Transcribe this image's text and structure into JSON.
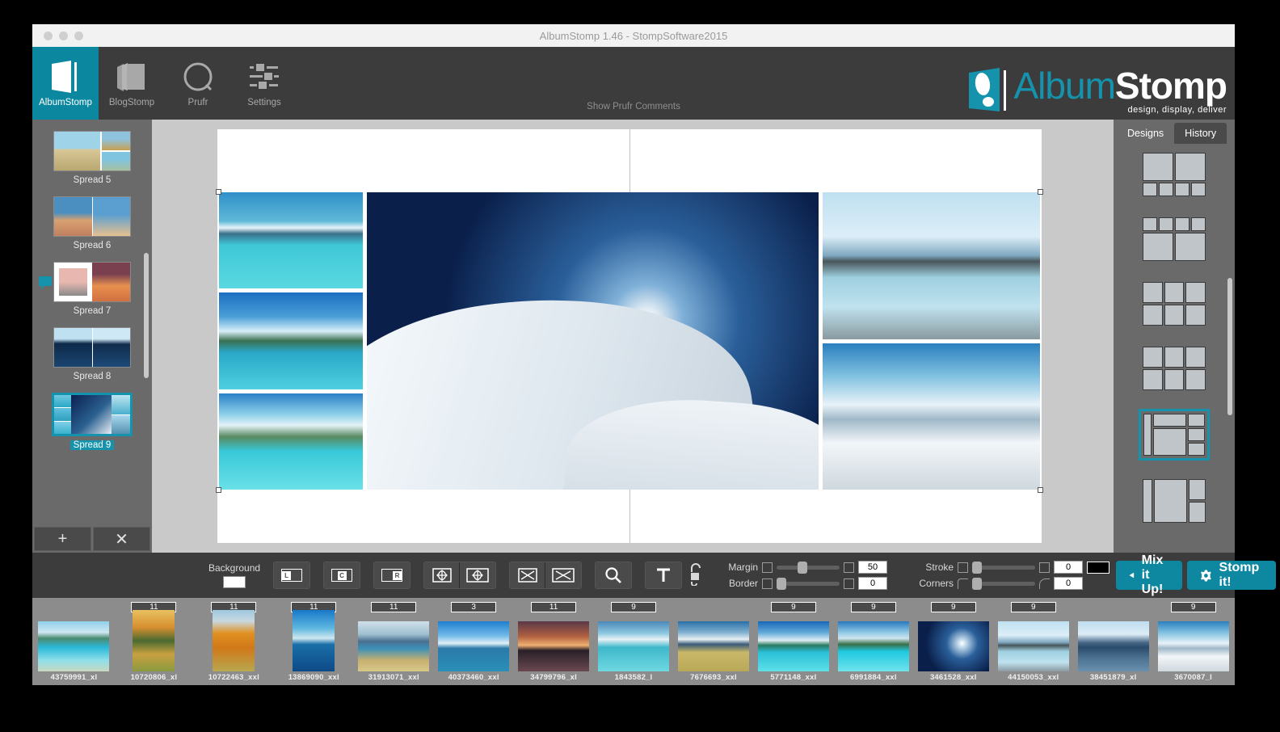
{
  "window": {
    "title": "AlbumStomp 1.46 - StompSoftware2015"
  },
  "topnav": {
    "items": [
      {
        "label": "AlbumStomp",
        "icon": "album-icon",
        "active": true
      },
      {
        "label": "BlogStomp",
        "icon": "blog-icon",
        "active": false
      },
      {
        "label": "Prufr",
        "icon": "circle-icon",
        "active": false
      },
      {
        "label": "Settings",
        "icon": "sliders-icon",
        "active": false
      }
    ],
    "prufr_link": "Show Prufr Comments",
    "logo": {
      "left": "Album",
      "right": "Stomp",
      "tagline": "design, display, deliver"
    }
  },
  "sidebar": {
    "spreads": [
      {
        "label": "Spread 5",
        "selected": false,
        "comment": false
      },
      {
        "label": "Spread 6",
        "selected": false,
        "comment": false
      },
      {
        "label": "Spread 7",
        "selected": false,
        "comment": true
      },
      {
        "label": "Spread 8",
        "selected": false,
        "comment": false
      },
      {
        "label": "Spread 9",
        "selected": true,
        "comment": false
      }
    ],
    "add_label": "+",
    "remove_label": "✕"
  },
  "rightpanel": {
    "tabs": [
      {
        "label": "Designs",
        "active": true
      },
      {
        "label": "History",
        "active": false
      }
    ],
    "selected_design_index": 4
  },
  "toolbar": {
    "menu_icon": "hamburger-icon",
    "background_label": "Background",
    "background_color": "#ffffff",
    "align_left": "L",
    "align_center": "C",
    "align_right": "R",
    "zoom_icon": "search-icon",
    "text_icon": "text-icon",
    "lock_icon": "unlock-icon",
    "margin_label": "Margin",
    "margin_value": "50",
    "border_label": "Border",
    "border_value": "0",
    "stroke_label": "Stroke",
    "stroke_value": "0",
    "stroke_color": "#000000",
    "corners_label": "Corners",
    "corners_value": "0",
    "mix_label": "Mix it Up!",
    "stomp_label": "Stomp it!",
    "accent_color": "#0e87a1"
  },
  "filmstrip": [
    {
      "name": "43759991_xl",
      "badge": "",
      "orientation": "landscape"
    },
    {
      "name": "10720806_xl",
      "badge": "11",
      "orientation": "portrait"
    },
    {
      "name": "10722463_xxl",
      "badge": "11",
      "orientation": "portrait"
    },
    {
      "name": "13869090_xxl",
      "badge": "11",
      "orientation": "portrait"
    },
    {
      "name": "31913071_xxl",
      "badge": "11",
      "orientation": "landscape"
    },
    {
      "name": "40373460_xxl",
      "badge": "3",
      "orientation": "landscape"
    },
    {
      "name": "34799796_xl",
      "badge": "11",
      "orientation": "landscape"
    },
    {
      "name": "1843582_l",
      "badge": "9",
      "orientation": "landscape"
    },
    {
      "name": "7676693_xxl",
      "badge": "",
      "orientation": "landscape"
    },
    {
      "name": "5771148_xxl",
      "badge": "9",
      "orientation": "landscape"
    },
    {
      "name": "6991884_xxl",
      "badge": "9",
      "orientation": "landscape"
    },
    {
      "name": "3461528_xxl",
      "badge": "9",
      "orientation": "landscape"
    },
    {
      "name": "44150053_xxl",
      "badge": "9",
      "orientation": "landscape"
    },
    {
      "name": "38451879_xl",
      "badge": "",
      "orientation": "landscape"
    },
    {
      "name": "3670087_l",
      "badge": "9",
      "orientation": "landscape"
    }
  ]
}
